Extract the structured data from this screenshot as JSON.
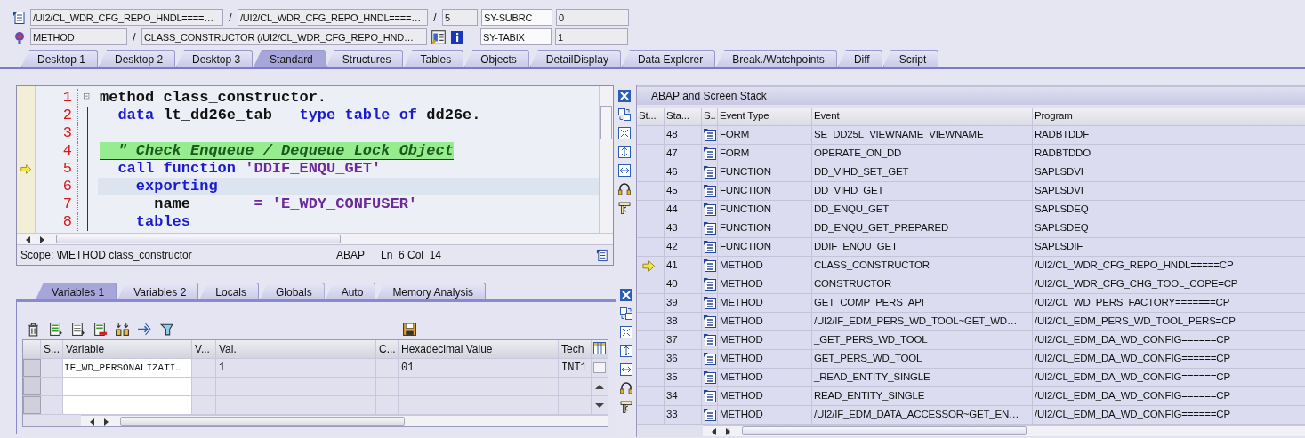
{
  "header": {
    "program": "/UI2/CL_WDR_CFG_REPO_HNDL====…",
    "separators": [
      "/",
      "/",
      "/"
    ],
    "include": "/UI2/CL_WDR_CFG_REPO_HNDL====…",
    "line": "5",
    "event_type": "METHOD",
    "event": "CLASS_CONSTRUCTOR (/UI2/CL_WDR_CFG_REPO_HND…",
    "system_fields": [
      {
        "name": "SY-SUBRC",
        "value": "0"
      },
      {
        "name": "SY-TABIX",
        "value": "1"
      }
    ]
  },
  "tabs": [
    {
      "label": "Desktop 1",
      "selected": false
    },
    {
      "label": "Desktop 2",
      "selected": false
    },
    {
      "label": "Desktop 3",
      "selected": false
    },
    {
      "label": "Standard",
      "selected": true
    },
    {
      "label": "Structures",
      "selected": false
    },
    {
      "label": "Tables",
      "selected": false
    },
    {
      "label": "Objects",
      "selected": false
    },
    {
      "label": "DetailDisplay",
      "selected": false
    },
    {
      "label": "Data Explorer",
      "selected": false
    },
    {
      "label": "Break./Watchpoints",
      "selected": false
    },
    {
      "label": "Diff",
      "selected": false
    },
    {
      "label": "Script",
      "selected": false
    }
  ],
  "editor": {
    "lines": [
      {
        "number": "1",
        "current": false,
        "highlighted": false,
        "foldable": true,
        "segments": [
          {
            "kind": "plain",
            "text": "method class_constructor."
          }
        ]
      },
      {
        "number": "2",
        "current": false,
        "highlighted": false,
        "foldable": false,
        "segments": [
          {
            "kind": "keyword",
            "text": "  data"
          },
          {
            "kind": "plain",
            "text": " lt_dd26e_tab   "
          },
          {
            "kind": "keyword",
            "text": "type table of"
          },
          {
            "kind": "plain",
            "text": " dd26e."
          }
        ]
      },
      {
        "number": "3",
        "current": false,
        "highlighted": false,
        "foldable": false
      },
      {
        "number": "4",
        "current": false,
        "highlighted": false,
        "foldable": false,
        "segments": [
          {
            "kind": "comment",
            "text": "  \" Check Enqueue / Dequeue Lock Object"
          }
        ]
      },
      {
        "number": "5",
        "current": true,
        "highlighted": false,
        "foldable": false,
        "segments": [
          {
            "kind": "keyword",
            "text": "  call function"
          },
          {
            "kind": "string",
            "text": " 'DDIF_ENQU_GET'"
          }
        ]
      },
      {
        "number": "6",
        "current": false,
        "highlighted": true,
        "foldable": false,
        "segments": [
          {
            "kind": "keyword",
            "text": "    exporting"
          }
        ]
      },
      {
        "number": "7",
        "current": false,
        "highlighted": false,
        "foldable": false,
        "segments": [
          {
            "kind": "plain",
            "text": "      name"
          },
          {
            "kind": "string",
            "text": "       = 'E_WDY_CONFUSER'"
          }
        ]
      },
      {
        "number": "8",
        "current": false,
        "highlighted": false,
        "foldable": false,
        "segments": [
          {
            "kind": "keyword",
            "text": "    tables"
          }
        ]
      }
    ],
    "status": {
      "scope": "Scope: \\METHOD class_constructor",
      "language": "ABAP",
      "position": "Ln  6 Col  14"
    }
  },
  "variables": {
    "tabs": [
      {
        "label": "Variables 1",
        "selected": true
      },
      {
        "label": "Variables 2",
        "selected": false
      },
      {
        "label": "Locals",
        "selected": false
      },
      {
        "label": "Globals",
        "selected": false
      },
      {
        "label": "Auto",
        "selected": false
      },
      {
        "label": "Memory Analysis",
        "selected": false
      }
    ],
    "columns": [
      "S...",
      "Variable",
      "V...",
      "Val.",
      "C...",
      "Hexadecimal Value",
      "Tech"
    ],
    "rows": [
      {
        "variable": "IF_WD_PERSONALIZATI…",
        "value": "1",
        "hex_value": "01",
        "technical_type": "INT1"
      }
    ]
  },
  "stack": {
    "title": "ABAP and Screen Stack",
    "columns": [
      "St...",
      "Sta...",
      "S..",
      "Event Type",
      "Event",
      "Program"
    ],
    "rows": [
      {
        "level": "48",
        "event_type": "FORM",
        "event": "SE_DD25L_VIEWNAME_VIEWNAME",
        "program": "RADBTDDF",
        "current": false
      },
      {
        "level": "47",
        "event_type": "FORM",
        "event": "OPERATE_ON_DD",
        "program": "RADBTDDO",
        "current": false
      },
      {
        "level": "46",
        "event_type": "FUNCTION",
        "event": "DD_VIHD_SET_GET",
        "program": "SAPLSDVI",
        "current": false
      },
      {
        "level": "45",
        "event_type": "FUNCTION",
        "event": "DD_VIHD_GET",
        "program": "SAPLSDVI",
        "current": false
      },
      {
        "level": "44",
        "event_type": "FUNCTION",
        "event": "DD_ENQU_GET",
        "program": "SAPLSDEQ",
        "current": false
      },
      {
        "level": "43",
        "event_type": "FUNCTION",
        "event": "DD_ENQU_GET_PREPARED",
        "program": "SAPLSDEQ",
        "current": false
      },
      {
        "level": "42",
        "event_type": "FUNCTION",
        "event": "DDIF_ENQU_GET",
        "program": "SAPLSDIF",
        "current": false
      },
      {
        "level": "41",
        "event_type": "METHOD",
        "event": "CLASS_CONSTRUCTOR",
        "program": "/UI2/CL_WDR_CFG_REPO_HNDL=====CP",
        "current": true
      },
      {
        "level": "40",
        "event_type": "METHOD",
        "event": "CONSTRUCTOR",
        "program": "/UI2/CL_WDR_CFG_CHG_TOOL_COPE=CP",
        "current": false
      },
      {
        "level": "39",
        "event_type": "METHOD",
        "event": "GET_COMP_PERS_API",
        "program": "/UI2/CL_WD_PERS_FACTORY=======CP",
        "current": false
      },
      {
        "level": "38",
        "event_type": "METHOD",
        "event": "/UI2/IF_EDM_PERS_WD_TOOL~GET_WD…",
        "program": "/UI2/CL_EDM_PERS_WD_TOOL_PERS=CP",
        "current": false
      },
      {
        "level": "37",
        "event_type": "METHOD",
        "event": "_GET_PERS_WD_TOOL",
        "program": "/UI2/CL_EDM_DA_WD_CONFIG======CP",
        "current": false
      },
      {
        "level": "36",
        "event_type": "METHOD",
        "event": "GET_PERS_WD_TOOL",
        "program": "/UI2/CL_EDM_DA_WD_CONFIG======CP",
        "current": false
      },
      {
        "level": "35",
        "event_type": "METHOD",
        "event": "_READ_ENTITY_SINGLE",
        "program": "/UI2/CL_EDM_DA_WD_CONFIG======CP",
        "current": false
      },
      {
        "level": "34",
        "event_type": "METHOD",
        "event": "READ_ENTITY_SINGLE",
        "program": "/UI2/CL_EDM_DA_WD_CONFIG======CP",
        "current": false
      },
      {
        "level": "33",
        "event_type": "METHOD",
        "event": "/UI2/IF_EDM_DATA_ACCESSOR~GET_EN…",
        "program": "/UI2/CL_EDM_DA_WD_CONFIG======CP",
        "current": false
      }
    ]
  }
}
